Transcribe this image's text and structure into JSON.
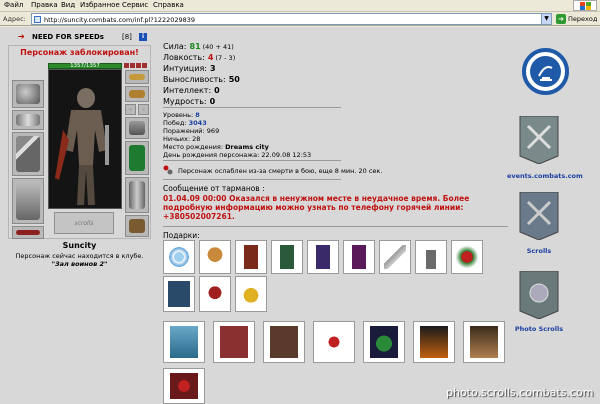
{
  "menu": [
    "Файл",
    "Правка",
    "Вид",
    "Избранное",
    "Сервис",
    "Справка"
  ],
  "address": {
    "label": "Адрес:",
    "url": "http://suncity.combats.com/inf.pl?1222029839",
    "go_label": "Переход"
  },
  "character": {
    "nick": "NEED FOR SPEEDs",
    "level": "[8]",
    "info_icon": "i",
    "blocked": "Персонаж заблокирован!",
    "hp": "1357/1357",
    "name": "Suncity",
    "location": "Персонаж сейчас находится в клубе.",
    "room": "\"Зал воинов 2\""
  },
  "stats": [
    {
      "label": "Сила:",
      "value": "81",
      "extra": "(40 + 41)",
      "color": "#1a8a1a"
    },
    {
      "label": "Ловкость:",
      "value": "4",
      "extra": "(7 - 3)",
      "color": "#c01010"
    },
    {
      "label": "Интуиция:",
      "value": "3",
      "extra": "",
      "color": "#000000"
    },
    {
      "label": "Выносливость:",
      "value": "50",
      "extra": "",
      "color": "#000000"
    },
    {
      "label": "Интеллект:",
      "value": "0",
      "extra": "",
      "color": "#000000"
    },
    {
      "label": "Мудрость:",
      "value": "0",
      "extra": "",
      "color": "#000000"
    }
  ],
  "info": {
    "level_label": "Уровень:",
    "level_value": "8",
    "wins_label": "Побед:",
    "wins_value": "3043",
    "losses_label": "Поражений:",
    "losses_value": "969",
    "draws_label": "Ничьих:",
    "draws_value": "28",
    "birthplace_label": "Место рождения:",
    "birthplace_value": "Dreams city",
    "birthday_label": "День рождения персонажа:",
    "birthday_value": "22.09.08 12:53"
  },
  "weakened": "Персонаж ослаблен из-за смерти в бою, еще 8 мин. 20 сек.",
  "message": {
    "title": "Сообщение от тарманов :",
    "body": "01.04.09 00:00 Оказался в ненужном месте в неудачное время. Более подробную информацию можно узнать по телефону горячей линии: +380502007261."
  },
  "gifts_label": "Подарки:",
  "gift_icons": [
    "snowflake-gift",
    "teddy-bear-gift",
    "card-gift",
    "green-card-gift",
    "purple-card-gift",
    "purple-book-gift",
    "keychain-gift",
    "statue-gift",
    "christmas-ornament-gift",
    "banner-gift",
    "rocking-horse-gift",
    "bell-gift"
  ],
  "card_icons": [
    "snow-card",
    "red-card",
    "rose-card",
    "valentine-card",
    "christmas-tree-card",
    "fire-card",
    "knight-card"
  ],
  "card_row2_icons": [
    "wreath-card"
  ],
  "right": {
    "events_label": "events.combats.com",
    "scrolls_label": "Scrolls",
    "photo_label": "Photo Scrolls"
  },
  "watermark": "photo.scrolls.combats.com",
  "colors": {
    "blocked": "#c01010",
    "emblem": "#1f5aa8",
    "link": "#1a3fa0"
  }
}
